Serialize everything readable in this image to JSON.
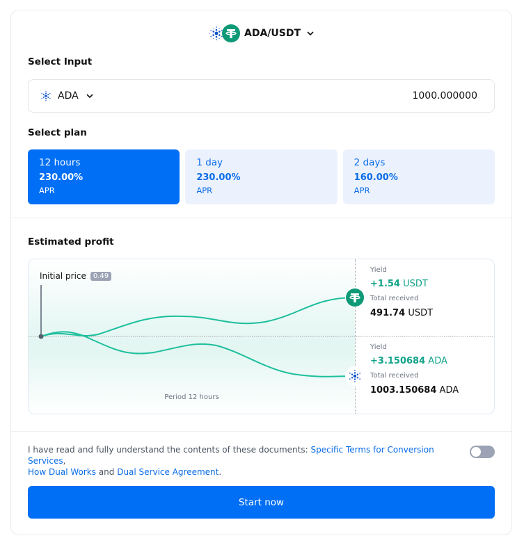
{
  "pair": {
    "label": "ADA/USDT",
    "base_icon": "cardano-icon",
    "quote_icon": "tether-icon"
  },
  "input_section": {
    "title": "Select Input",
    "token": "ADA",
    "amount": "1000.000000"
  },
  "plan_section": {
    "title": "Select plan",
    "plans": [
      {
        "duration": "12 hours",
        "apr": "230.00%",
        "apr_label": "APR",
        "selected": true
      },
      {
        "duration": "1 day",
        "apr": "230.00%",
        "apr_label": "APR",
        "selected": false
      },
      {
        "duration": "2 days",
        "apr": "160.00%",
        "apr_label": "APR",
        "selected": false
      }
    ]
  },
  "profit_section": {
    "title": "Estimated profit",
    "initial_price_label": "Initial price",
    "initial_price": "0.49",
    "period_label": "Period 12 hours",
    "outcomes": [
      {
        "yield_label": "Yield",
        "yield_value": "+1.54",
        "yield_unit": "USDT",
        "total_label": "Total received",
        "total_value": "491.74",
        "total_unit": "USDT",
        "icon": "tether-icon"
      },
      {
        "yield_label": "Yield",
        "yield_value": "+3.150684",
        "yield_unit": "ADA",
        "total_label": "Total received",
        "total_value": "1003.150684",
        "total_unit": "ADA",
        "icon": "cardano-icon"
      }
    ]
  },
  "agreement": {
    "text_before": "I have read and fully understand the contents of these documents: ",
    "link1": "Specific Terms for Conversion Services",
    "sep1": ",",
    "link2": "How Dual Works",
    "mid": " and ",
    "link3": "Dual Service Agreement",
    "end": ".",
    "toggle_on": false
  },
  "start_button": "Start now",
  "colors": {
    "primary": "#006ef5",
    "accent_green": "#12a389",
    "tether_green": "#0f9a77",
    "cardano_blue": "#0a52c9"
  }
}
